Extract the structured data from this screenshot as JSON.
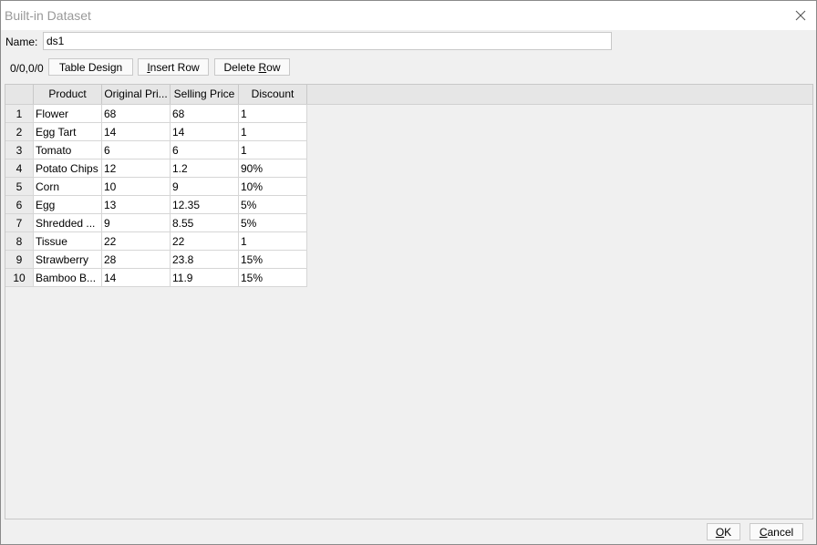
{
  "window": {
    "title": "Built-in Dataset"
  },
  "name_field": {
    "label": "Name:",
    "value": "ds1"
  },
  "toolbar": {
    "counter": "0/0,0/0",
    "table_design": "Table Design",
    "insert_row_prefix": "I",
    "insert_row_rest": "nsert Row",
    "delete_row_prefix": "Delete ",
    "delete_row_mnemonic": "R",
    "delete_row_rest": "ow"
  },
  "table": {
    "columns": [
      "Product",
      "Original Pri...",
      "Selling Price",
      "Discount"
    ],
    "rows": [
      {
        "num": "1",
        "cells": [
          "Flower",
          "68",
          "68",
          "1"
        ]
      },
      {
        "num": "2",
        "cells": [
          "Egg Tart",
          "14",
          "14",
          "1"
        ]
      },
      {
        "num": "3",
        "cells": [
          "Tomato",
          "6",
          "6",
          "1"
        ]
      },
      {
        "num": "4",
        "cells": [
          "Potato Chips",
          "12",
          "1.2",
          "90%"
        ]
      },
      {
        "num": "5",
        "cells": [
          "Corn",
          "10",
          "9",
          "10%"
        ]
      },
      {
        "num": "6",
        "cells": [
          "Egg",
          "13",
          "12.35",
          "5%"
        ]
      },
      {
        "num": "7",
        "cells": [
          "Shredded ...",
          "9",
          "8.55",
          "5%"
        ]
      },
      {
        "num": "8",
        "cells": [
          "Tissue",
          "22",
          "22",
          "1"
        ]
      },
      {
        "num": "9",
        "cells": [
          "Strawberry",
          "28",
          "23.8",
          "15%"
        ]
      },
      {
        "num": "10",
        "cells": [
          "Bamboo B...",
          "14",
          "11.9",
          "15%"
        ]
      }
    ]
  },
  "footer": {
    "ok_mnemonic": "O",
    "ok_rest": "K",
    "cancel_mnemonic": "C",
    "cancel_rest": "ancel"
  }
}
